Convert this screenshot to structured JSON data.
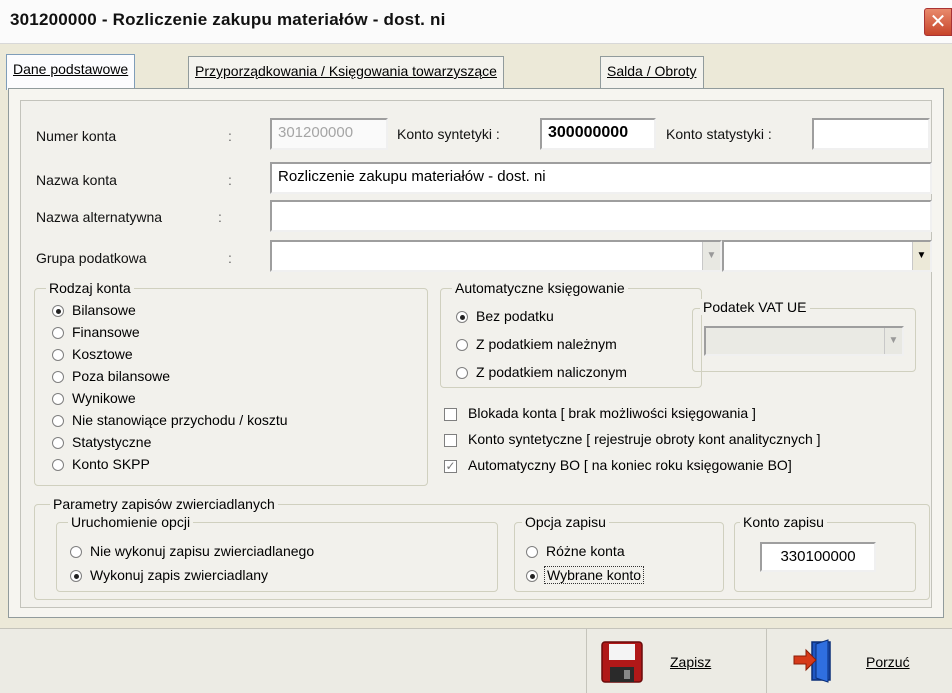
{
  "window": {
    "title": "301200000 - Rozliczenie zakupu materiałów - dost. ni",
    "close_glyph": "✕"
  },
  "tabs": [
    {
      "label": "Dane podstawowe",
      "active": true
    },
    {
      "label": "Przyporządkowania / Księgowania towarzyszące",
      "active": false
    },
    {
      "label": "Salda / Obroty",
      "active": false
    }
  ],
  "form": {
    "colon": ":",
    "numer_konta": {
      "label": "Numer konta",
      "value": "301200000"
    },
    "konto_syntetyki": {
      "label": "Konto syntetyki :",
      "value": "300000000"
    },
    "konto_statystyki": {
      "label": "Konto statystyki :",
      "value": ""
    },
    "nazwa_konta": {
      "label": "Nazwa konta",
      "value": "Rozliczenie zakupu materiałów - dost. ni"
    },
    "nazwa_alternatywna": {
      "label": "Nazwa alternatywna",
      "value": ""
    },
    "grupa_podatkowa": {
      "label": "Grupa podatkowa",
      "value": "",
      "value2": ""
    }
  },
  "rodzaj_konta": {
    "title": "Rodzaj konta",
    "options": [
      {
        "label": "Bilansowe",
        "checked": true
      },
      {
        "label": "Finansowe",
        "checked": false
      },
      {
        "label": "Kosztowe",
        "checked": false
      },
      {
        "label": "Poza bilansowe",
        "checked": false
      },
      {
        "label": "Wynikowe",
        "checked": false
      },
      {
        "label": "Nie stanowiące przychodu / kosztu",
        "checked": false
      },
      {
        "label": "Statystyczne",
        "checked": false
      },
      {
        "label": "Konto SKPP",
        "checked": false
      }
    ]
  },
  "auto_ksiegowanie": {
    "title": "Automatyczne księgowanie",
    "options": [
      {
        "label": "Bez podatku",
        "checked": true
      },
      {
        "label": "Z podatkiem należnym",
        "checked": false
      },
      {
        "label": "Z podatkiem naliczonym",
        "checked": false
      }
    ],
    "vat_ue": {
      "title": "Podatek VAT UE",
      "value": ""
    }
  },
  "checkboxes": [
    {
      "label": "Blokada konta [ brak możliwości księgowania ]",
      "checked": false,
      "disabled": false
    },
    {
      "label": "Konto syntetyczne [ rejestruje obroty kont analitycznych ]",
      "checked": false,
      "disabled": false
    },
    {
      "label": "Automatyczny BO [ na koniec roku księgowanie BO]",
      "checked": true,
      "disabled": true
    }
  ],
  "parametry": {
    "title": "Parametry zapisów zwierciadlanych",
    "uruchomienie": {
      "title": "Uruchomienie opcji",
      "options": [
        {
          "label": "Nie wykonuj zapisu zwierciadlanego",
          "checked": false
        },
        {
          "label": "Wykonuj zapis zwierciadlany",
          "checked": true
        }
      ]
    },
    "opcja_zapisu": {
      "title": "Opcja zapisu",
      "options": [
        {
          "label": "Różne konta",
          "checked": false
        },
        {
          "label": "Wybrane konto",
          "checked": true
        }
      ]
    },
    "konto_zapisu": {
      "title": "Konto zapisu",
      "value": "330100000"
    }
  },
  "buttons": {
    "save_label": "Zapisz",
    "cancel_label": "Porzuć"
  },
  "colors": {
    "save_icon": "#b01818",
    "cancel_door": "#1f57c3",
    "cancel_arrow": "#d63a1a"
  }
}
